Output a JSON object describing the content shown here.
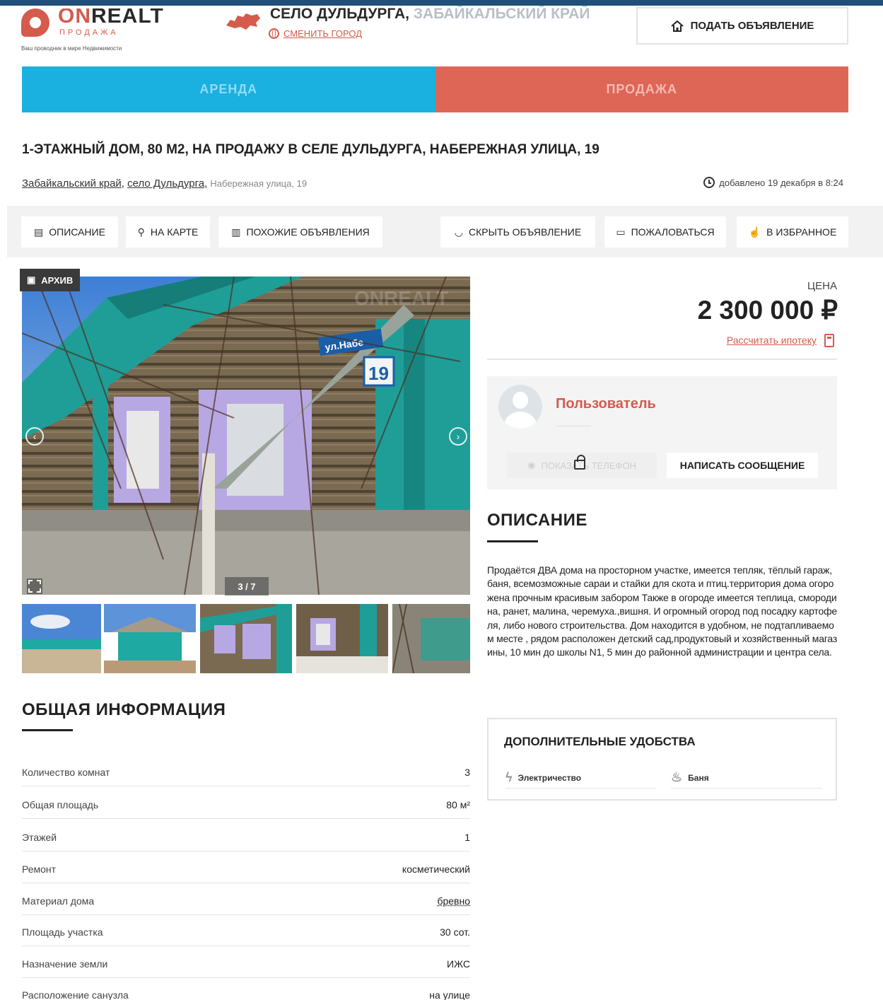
{
  "header": {
    "logo_text_accent": "ON",
    "logo_text_main": "REALT",
    "logo_sub": "ПРОДАЖА",
    "logo_tagline": "Ваш проводник в мире Недвижимости",
    "city_name": "СЕЛО ДУЛЬДУРГА,",
    "city_region": " ЗАБАЙКАЛЬСКИЙ КРАЙ",
    "change_city": "СМЕНИТЬ ГОРОД",
    "post_ad": "ПОДАТЬ ОБЪЯВЛЕНИЕ"
  },
  "mode_tabs": {
    "rent": "АРЕНДА",
    "sale": "ПРОДАЖА"
  },
  "listing": {
    "title": "1-ЭТАЖНЫЙ ДОМ, 80 М2, НА ПРОДАЖУ В СЕЛЕ ДУЛЬДУРГА, НАБЕРЕЖНАЯ УЛИЦА, 19",
    "address_region": "Забайкальский край",
    "address_sep": ", ",
    "address_village": "село Дульдурга",
    "address_sep2": ", ",
    "address_street": "Набережная улица, 19",
    "added": "добавлено 19 декабря в 8:24"
  },
  "actions": {
    "description": "ОПИСАНИЕ",
    "on_map": "НА КАРТЕ",
    "similar": "ПОХОЖИЕ ОБЪЯВЛЕНИЯ",
    "hide": "СКРЫТЬ ОБЪЯВЛЕНИЕ",
    "complain": "ПОЖАЛОВАТЬСЯ",
    "favorite": "В ИЗБРАННОЕ"
  },
  "gallery": {
    "archive_badge": "АРХИВ",
    "counter": "3 / 7",
    "sign_text": "ул.Набе",
    "house_number": "19",
    "watermark": "ONREALT"
  },
  "price": {
    "label": "ЦЕНА",
    "value": "2 300 000 ₽",
    "mortgage": "Рассчитать ипотеку"
  },
  "seller": {
    "name": "Пользователь",
    "show_phone": "ПОКАЗАТЬ ТЕЛЕФОН",
    "write_message": "НАПИСАТЬ СООБЩЕНИЕ"
  },
  "description": {
    "heading": "ОПИСАНИЕ",
    "text": "Продаётся ДВА дома на просторном участке, имеется тепляк, тёплый гараж, баня,  всемозможные сараи и стайки для скота и птиц.территория дома огорожена прочным красивым забором  Также в огороде имеется теплица, смородина, ранет, малина, черемуха.,вишня. И огромный огород под посадку картофеля, либо нового строительства. Дом находится в удобном, не подтапливаемом месте , рядом расположен детский сад,продуктовый и хозяйственный магазины, 10 мин до школы N1, 5 мин до районной администрации и центра села."
  },
  "amenities": {
    "heading": "ДОПОЛНИТЕЛЬНЫЕ УДОБСТВА",
    "items": [
      "Электричество",
      "Баня"
    ]
  },
  "general_info": {
    "heading": "ОБЩАЯ ИНФОРМАЦИЯ",
    "rows": [
      {
        "key": "Количество комнат",
        "value": "3"
      },
      {
        "key": "Общая площадь",
        "value": "80 м²"
      },
      {
        "key": "Этажей",
        "value": "1"
      },
      {
        "key": "Ремонт",
        "value": "косметический"
      },
      {
        "key": "Материал дома",
        "value": "бревно"
      },
      {
        "key": "Площадь участка",
        "value": "30 сот."
      },
      {
        "key": "Назначение земли",
        "value": "ИЖС"
      },
      {
        "key": "Расположение санузла",
        "value": "на улице"
      }
    ]
  },
  "colors": {
    "accent": "#d55b4c",
    "rent_tab": "#1ab0e0",
    "sale_tab": "#de6657",
    "topbar": "#1f4f7a"
  }
}
